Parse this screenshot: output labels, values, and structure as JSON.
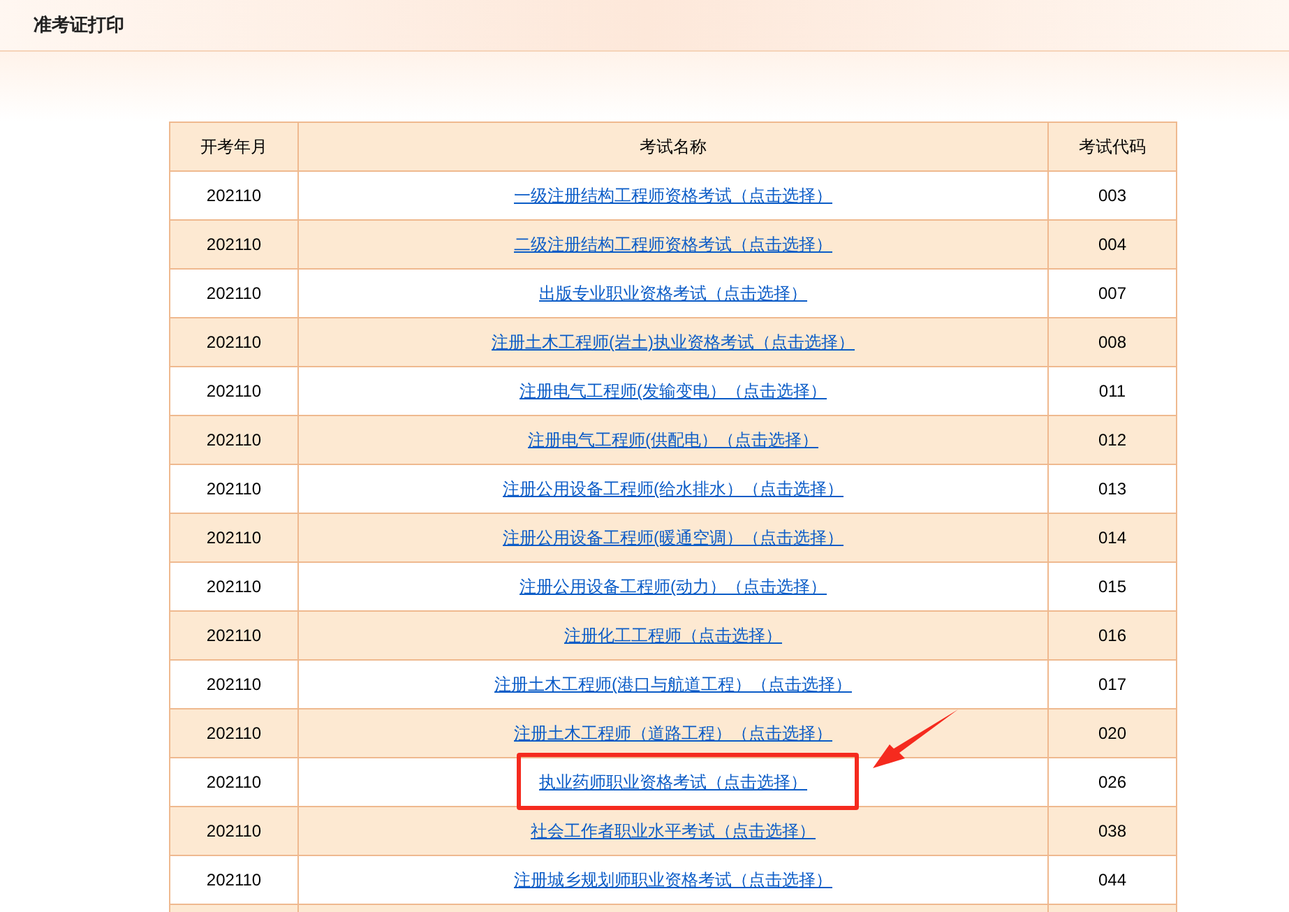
{
  "header": {
    "title": "准考证打印"
  },
  "table": {
    "columns": [
      "开考年月",
      "考试名称",
      "考试代码"
    ],
    "rows": [
      {
        "month": "202110",
        "name": "一级注册结构工程师资格考试（点击选择）",
        "code": "003",
        "highlighted": false
      },
      {
        "month": "202110",
        "name": "二级注册结构工程师资格考试（点击选择）",
        "code": "004",
        "highlighted": false
      },
      {
        "month": "202110",
        "name": "出版专业职业资格考试（点击选择）",
        "code": "007",
        "highlighted": false
      },
      {
        "month": "202110",
        "name": "注册土木工程师(岩土)执业资格考试（点击选择）",
        "code": "008",
        "highlighted": false
      },
      {
        "month": "202110",
        "name": "注册电气工程师(发输变电）（点击选择）",
        "code": "011",
        "highlighted": false
      },
      {
        "month": "202110",
        "name": "注册电气工程师(供配电）（点击选择）",
        "code": "012",
        "highlighted": false
      },
      {
        "month": "202110",
        "name": "注册公用设备工程师(给水排水）（点击选择）",
        "code": "013",
        "highlighted": false
      },
      {
        "month": "202110",
        "name": "注册公用设备工程师(暖通空调）（点击选择）",
        "code": "014",
        "highlighted": false
      },
      {
        "month": "202110",
        "name": "注册公用设备工程师(动力）（点击选择）",
        "code": "015",
        "highlighted": false
      },
      {
        "month": "202110",
        "name": "注册化工工程师（点击选择）",
        "code": "016",
        "highlighted": false
      },
      {
        "month": "202110",
        "name": "注册土木工程师(港口与航道工程）（点击选择）",
        "code": "017",
        "highlighted": false
      },
      {
        "month": "202110",
        "name": "注册土木工程师（道路工程）（点击选择）",
        "code": "020",
        "highlighted": false
      },
      {
        "month": "202110",
        "name": "执业药师职业资格考试（点击选择）",
        "code": "026",
        "highlighted": true
      },
      {
        "month": "202110",
        "name": "社会工作者职业水平考试（点击选择）",
        "code": "038",
        "highlighted": false
      },
      {
        "month": "202110",
        "name": "注册城乡规划师职业资格考试（点击选择）",
        "code": "044",
        "highlighted": false
      }
    ]
  }
}
